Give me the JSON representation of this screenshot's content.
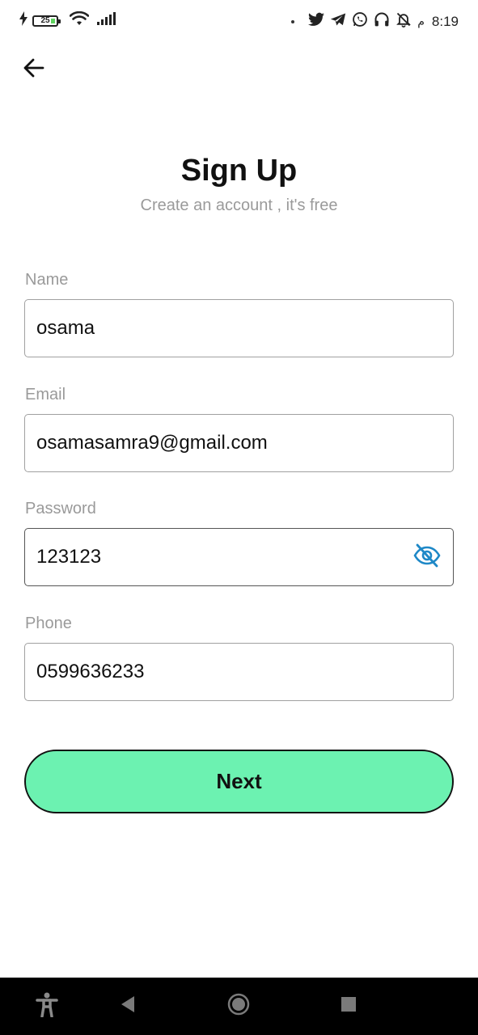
{
  "status_bar": {
    "battery_level": "25",
    "time": "8:19",
    "am_pm_indicator": "م"
  },
  "header": {
    "title": "Sign Up",
    "subtitle": "Create an account , it's free"
  },
  "form": {
    "name": {
      "label": "Name",
      "value": "osama"
    },
    "email": {
      "label": "Email",
      "value": "osamasamra9@gmail.com"
    },
    "password": {
      "label": "Password",
      "value": "123123",
      "toggle_icon": "eye-off-icon"
    },
    "phone": {
      "label": "Phone",
      "value": "0599636233"
    }
  },
  "actions": {
    "next_label": "Next"
  },
  "colors": {
    "accent_button": "#6cf2b1",
    "eye_icon": "#1e88c7",
    "label_gray": "#9a9a9a"
  }
}
